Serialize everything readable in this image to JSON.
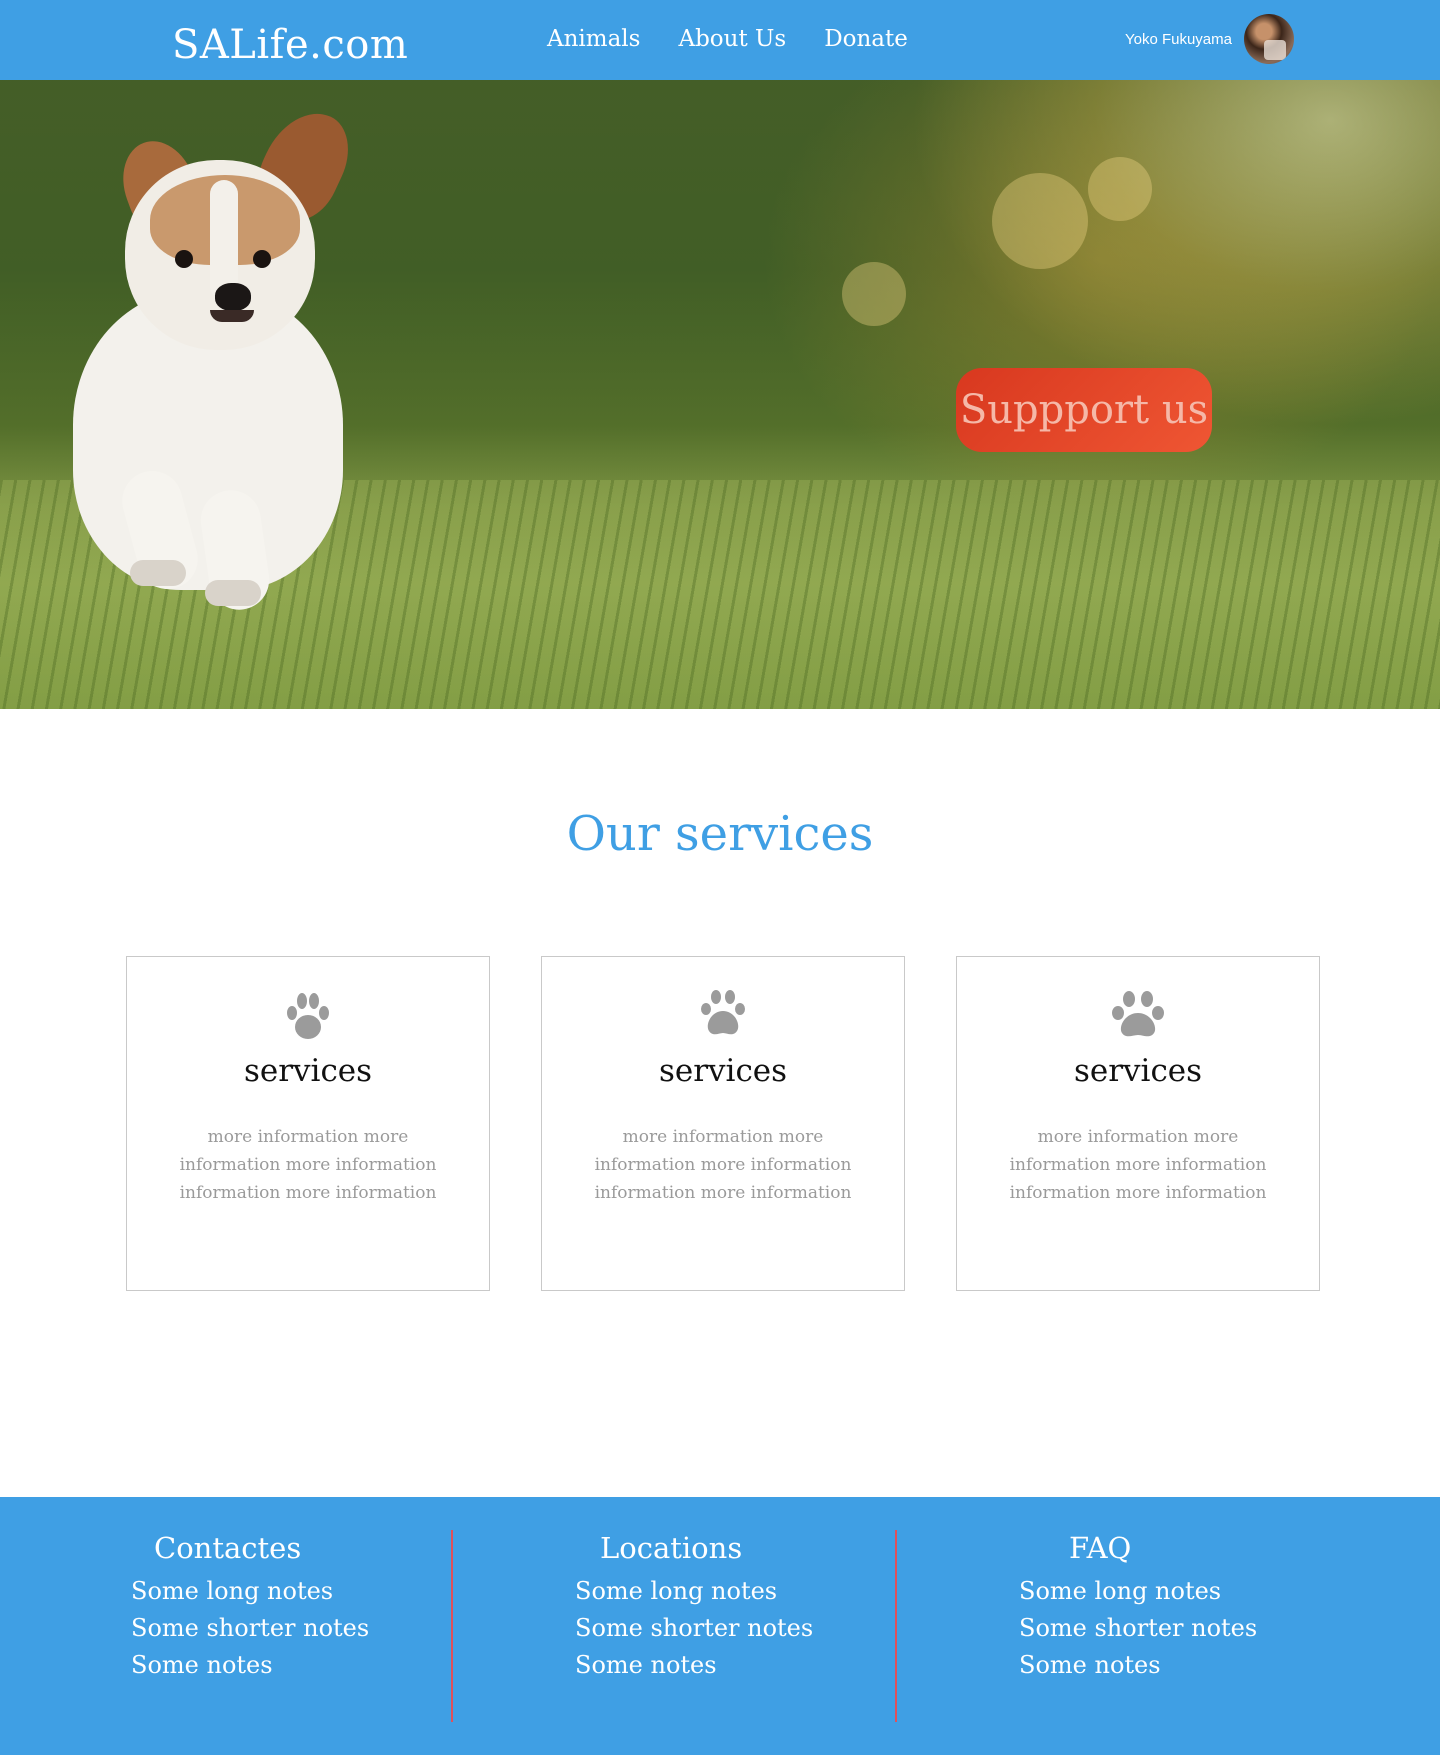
{
  "header": {
    "brand": "SALife.com",
    "nav": [
      "Animals",
      "About Us",
      "Donate"
    ],
    "user_name": "Yoko Fukuyama",
    "avatar_icon": "user-avatar-photo"
  },
  "hero": {
    "cta_label": "Suppport us",
    "image_subject": "dog-running-on-grass"
  },
  "services": {
    "title": "Our services",
    "cards": [
      {
        "icon": "paw-icon",
        "title": "services",
        "text": "more information more information more information information more information"
      },
      {
        "icon": "paw-icon",
        "title": "services",
        "text": "more information more information more information information more information"
      },
      {
        "icon": "paw-icon",
        "title": "services",
        "text": "more information more information more information information more information"
      }
    ]
  },
  "footer": {
    "columns": [
      {
        "title": "Contactes",
        "notes": [
          "Some long notes",
          "Some shorter notes",
          "Some notes"
        ]
      },
      {
        "title": "Locations",
        "notes": [
          "Some long notes",
          "Some shorter notes",
          "Some notes"
        ]
      },
      {
        "title": "FAQ",
        "notes": [
          "Some long notes",
          "Some shorter notes",
          "Some notes"
        ]
      }
    ]
  },
  "colors": {
    "primary": "#3f9fe4",
    "cta": "#e2452a",
    "cta_text": "#f5b8a8",
    "separator": "#e0505a",
    "muted_text": "#9a9a9a",
    "paw_icon": "#9b9b9b"
  }
}
